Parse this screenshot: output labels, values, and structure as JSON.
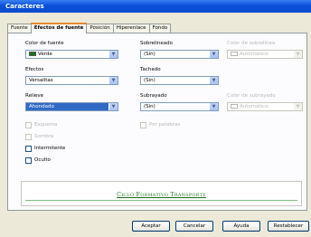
{
  "window": {
    "title": "Caracteres"
  },
  "tabs": [
    "Fuente",
    "Efectos de fuente",
    "Posición",
    "Hiperenlace",
    "Fondo"
  ],
  "left": {
    "font_color_label": "Color de fuente",
    "font_color_value": "Verde",
    "font_color_swatch": "#1a7a1a",
    "effects_label": "Efectos",
    "effects_value": "Versalitas",
    "relief_label": "Relieve",
    "relief_value": "Ahondado",
    "checkboxes": [
      {
        "label": "Esquema",
        "enabled": false
      },
      {
        "label": "Sombra",
        "enabled": false
      },
      {
        "label": "Intermitente",
        "enabled": true
      },
      {
        "label": "Oculto",
        "enabled": true
      }
    ]
  },
  "middle": {
    "overline_label": "Sobrelineado",
    "overline_value": "(Sin)",
    "strike_label": "Tachado",
    "strike_value": "(Sin)",
    "underline_label": "Subrayado",
    "underline_value": "(Sin)",
    "words_only_label": "Por palabras"
  },
  "right": {
    "overline_color_label": "Color de sobrelínea",
    "overline_color_value": "Automático",
    "underline_color_label": "Color de subrayado",
    "underline_color_value": "Automático"
  },
  "preview": {
    "text": "Ciclo Formativo Transporte"
  },
  "buttons": {
    "accept": "Aceptar",
    "cancel": "Cancelar",
    "help": "Ayuda",
    "reset": "Restablecer"
  },
  "colors": {
    "titlebar": "#0a50d8",
    "selection": "#316ac5",
    "preview_text": "#2a7a2a"
  }
}
